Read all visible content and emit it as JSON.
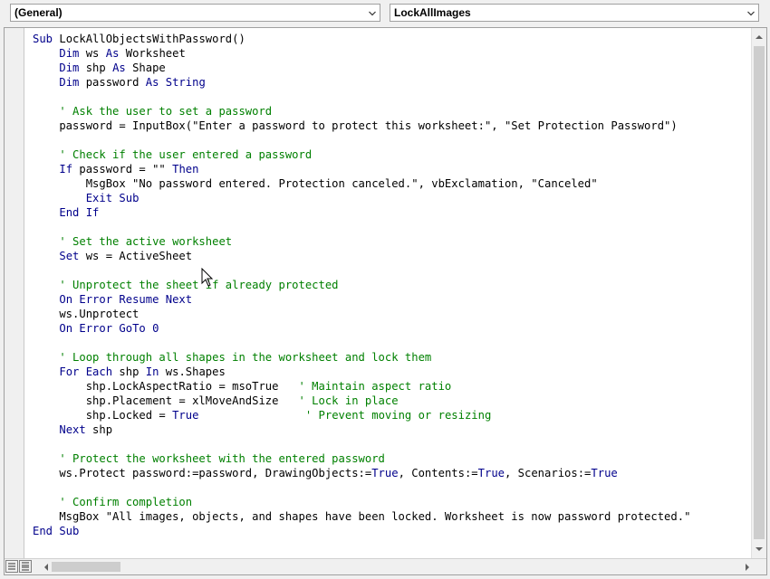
{
  "object_combo": {
    "value": "(General)"
  },
  "procedure_combo": {
    "value": "LockAllImages"
  },
  "icons": {
    "dropdown_arrow": "chevron-down-icon",
    "view_procedure": "procedure-view-icon",
    "view_full_module": "full-module-view-icon",
    "mouse_cursor": "arrow-pointer-icon"
  },
  "colors": {
    "keyword": "#00008b",
    "comment": "#008000",
    "text": "#000000"
  },
  "code_lines": [
    [
      {
        "t": "Sub ",
        "k": "kw"
      },
      {
        "t": "LockAllObjectsWithPassword()",
        "k": "tx"
      }
    ],
    [
      {
        "t": "    ",
        "k": "tx"
      },
      {
        "t": "Dim",
        "k": "kw"
      },
      {
        "t": " ws ",
        "k": "tx"
      },
      {
        "t": "As",
        "k": "kw"
      },
      {
        "t": " Worksheet",
        "k": "tx"
      }
    ],
    [
      {
        "t": "    ",
        "k": "tx"
      },
      {
        "t": "Dim",
        "k": "kw"
      },
      {
        "t": " shp ",
        "k": "tx"
      },
      {
        "t": "As",
        "k": "kw"
      },
      {
        "t": " Shape",
        "k": "tx"
      }
    ],
    [
      {
        "t": "    ",
        "k": "tx"
      },
      {
        "t": "Dim",
        "k": "kw"
      },
      {
        "t": " password ",
        "k": "tx"
      },
      {
        "t": "As String",
        "k": "kw"
      }
    ],
    [],
    [
      {
        "t": "    ' Ask the user to set a password",
        "k": "cm"
      }
    ],
    [
      {
        "t": "    password = InputBox(\"Enter a password to protect this worksheet:\", \"Set Protection Password\")",
        "k": "tx"
      }
    ],
    [],
    [
      {
        "t": "    ' Check if the user entered a password",
        "k": "cm"
      }
    ],
    [
      {
        "t": "    ",
        "k": "tx"
      },
      {
        "t": "If",
        "k": "kw"
      },
      {
        "t": " password = \"\" ",
        "k": "tx"
      },
      {
        "t": "Then",
        "k": "kw"
      }
    ],
    [
      {
        "t": "        MsgBox \"No password entered. Protection canceled.\", vbExclamation, \"Canceled\"",
        "k": "tx"
      }
    ],
    [
      {
        "t": "        ",
        "k": "tx"
      },
      {
        "t": "Exit Sub",
        "k": "kw"
      }
    ],
    [
      {
        "t": "    ",
        "k": "tx"
      },
      {
        "t": "End If",
        "k": "kw"
      }
    ],
    [],
    [
      {
        "t": "    ' Set the active worksheet",
        "k": "cm"
      }
    ],
    [
      {
        "t": "    ",
        "k": "tx"
      },
      {
        "t": "Set",
        "k": "kw"
      },
      {
        "t": " ws = ActiveSheet",
        "k": "tx"
      }
    ],
    [],
    [
      {
        "t": "    ' Unprotect the sheet if already protected",
        "k": "cm"
      }
    ],
    [
      {
        "t": "    ",
        "k": "tx"
      },
      {
        "t": "On Error Resume Next",
        "k": "kw"
      }
    ],
    [
      {
        "t": "    ws.Unprotect",
        "k": "tx"
      }
    ],
    [
      {
        "t": "    ",
        "k": "tx"
      },
      {
        "t": "On Error GoTo 0",
        "k": "kw"
      }
    ],
    [],
    [
      {
        "t": "    ' Loop through all shapes in the worksheet and lock them",
        "k": "cm"
      }
    ],
    [
      {
        "t": "    ",
        "k": "tx"
      },
      {
        "t": "For Each",
        "k": "kw"
      },
      {
        "t": " shp ",
        "k": "tx"
      },
      {
        "t": "In",
        "k": "kw"
      },
      {
        "t": " ws.Shapes",
        "k": "tx"
      }
    ],
    [
      {
        "t": "        shp.LockAspectRatio = msoTrue   ",
        "k": "tx"
      },
      {
        "t": "' Maintain aspect ratio",
        "k": "cm"
      }
    ],
    [
      {
        "t": "        shp.Placement = xlMoveAndSize   ",
        "k": "tx"
      },
      {
        "t": "' Lock in place",
        "k": "cm"
      }
    ],
    [
      {
        "t": "        shp.Locked = ",
        "k": "tx"
      },
      {
        "t": "True",
        "k": "kw"
      },
      {
        "t": "                ",
        "k": "tx"
      },
      {
        "t": "' Prevent moving or resizing",
        "k": "cm"
      }
    ],
    [
      {
        "t": "    ",
        "k": "tx"
      },
      {
        "t": "Next",
        "k": "kw"
      },
      {
        "t": " shp",
        "k": "tx"
      }
    ],
    [],
    [
      {
        "t": "    ' Protect the worksheet with the entered password",
        "k": "cm"
      }
    ],
    [
      {
        "t": "    ws.Protect password:=password, DrawingObjects:=",
        "k": "tx"
      },
      {
        "t": "True",
        "k": "kw"
      },
      {
        "t": ", Contents:=",
        "k": "tx"
      },
      {
        "t": "True",
        "k": "kw"
      },
      {
        "t": ", Scenarios:=",
        "k": "tx"
      },
      {
        "t": "True",
        "k": "kw"
      }
    ],
    [],
    [
      {
        "t": "    ' Confirm completion",
        "k": "cm"
      }
    ],
    [
      {
        "t": "    MsgBox \"All images, objects, and shapes have been locked. Worksheet is now password protected.\"",
        "k": "tx"
      }
    ],
    [
      {
        "t": "End Sub",
        "k": "kw"
      }
    ]
  ]
}
